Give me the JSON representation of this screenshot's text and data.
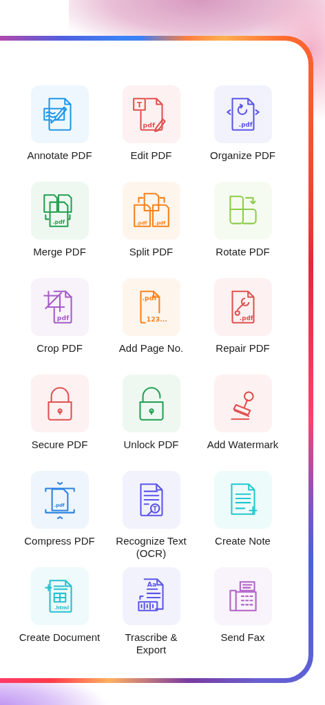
{
  "tools": [
    {
      "label": "Annotate PDF",
      "kind": "annotate",
      "color": "#2196e8"
    },
    {
      "label": "Edit PDF",
      "kind": "edit",
      "color": "#e0504f",
      "icon_texts": [
        "T",
        "pdf"
      ]
    },
    {
      "label": "Organize PDF",
      "kind": "organize",
      "color": "#5b55e8",
      "icon_texts": [
        ".pdf"
      ]
    },
    {
      "label": "Merge PDF",
      "kind": "merge",
      "color": "#22a050",
      "icon_texts": [
        ".pdf"
      ]
    },
    {
      "label": "Split PDF",
      "kind": "split",
      "color": "#f7821b",
      "icon_texts": [
        ".pdf",
        ".pdf"
      ]
    },
    {
      "label": "Rotate PDF",
      "kind": "rotate",
      "color": "#8ccc4a"
    },
    {
      "label": "Crop PDF",
      "kind": "crop",
      "color": "#a55ac8",
      "icon_texts": [
        "pdf"
      ]
    },
    {
      "label": "Add Page No.",
      "kind": "pagenumber",
      "color": "#f7821b",
      "icon_texts": [
        ".pdf",
        "123..."
      ]
    },
    {
      "label": "Repair PDF",
      "kind": "repair",
      "color": "#e0504f",
      "icon_texts": [
        ".pdf"
      ]
    },
    {
      "label": "Secure PDF",
      "kind": "lock",
      "color": "#e0504f"
    },
    {
      "label": "Unlock PDF",
      "kind": "unlock",
      "color": "#22a050"
    },
    {
      "label": "Add Watermark",
      "kind": "stamp",
      "color": "#e0504f"
    },
    {
      "label": "Compress PDF",
      "kind": "compress",
      "color": "#2a82e0",
      "icon_texts": [
        ".pdf"
      ]
    },
    {
      "label": "Recognize Text (OCR)",
      "kind": "ocr",
      "color": "#5b55e8",
      "icon_texts": [
        "T"
      ]
    },
    {
      "label": "Create Note",
      "kind": "note",
      "color": "#22c8d0"
    },
    {
      "label": "Create Document",
      "kind": "document",
      "color": "#22c0d0",
      "icon_texts": [
        ".html"
      ]
    },
    {
      "label": "Trascribe & Export",
      "kind": "transcribe",
      "color": "#5b55e8",
      "icon_texts": [
        "Aa"
      ]
    },
    {
      "label": "Send Fax",
      "kind": "fax",
      "color": "#b060c8"
    }
  ]
}
